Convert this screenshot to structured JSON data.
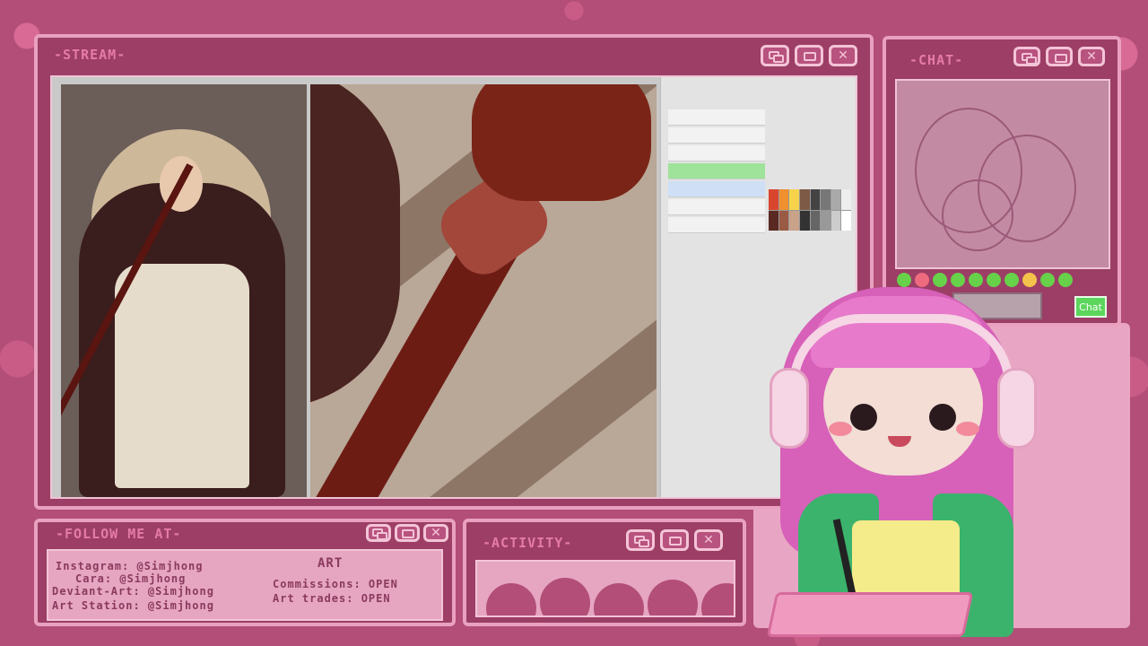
{
  "windows": {
    "stream": {
      "title": "-STREAM-"
    },
    "chat": {
      "title": "-CHAT-",
      "send_label": "Chat"
    },
    "follow": {
      "title": "-FOLLOW ME AT-",
      "heading": "ART",
      "lines": [
        "Instagram: @Simjhong",
        "Cara: @Simjhong",
        "Deviant-Art: @Simjhong",
        "Art Station: @Simjhong"
      ],
      "status": [
        "Commissions: OPEN",
        "Art trades: OPEN"
      ]
    },
    "activity": {
      "title": "-ACTIVITY-"
    }
  },
  "colors": {
    "background": "#b24e78",
    "frame": "#9c3e66",
    "border": "#e9a1bf",
    "title": "#e57ba7",
    "send": "#5cd65c"
  },
  "icons": [
    "restore-icon",
    "maximize-icon",
    "close-icon"
  ]
}
